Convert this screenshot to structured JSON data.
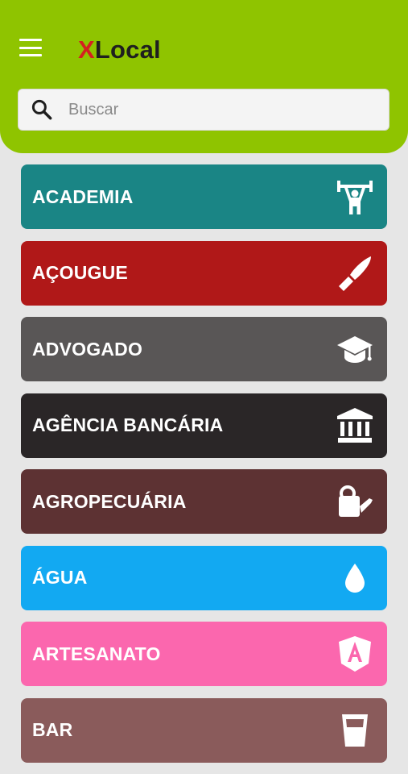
{
  "header": {
    "logo_x": "X",
    "logo_rest": "Local",
    "menu_icon": "hamburger-menu-icon"
  },
  "search": {
    "placeholder": "Buscar",
    "value": "",
    "icon": "search-icon"
  },
  "categories": [
    {
      "label": "ACADEMIA",
      "color": "#1a8585",
      "icon": "weightlifter-icon"
    },
    {
      "label": "AÇOUGUE",
      "color": "#b01818",
      "icon": "knife-icon"
    },
    {
      "label": "ADVOGADO",
      "color": "#595656",
      "icon": "graduation-cap-icon"
    },
    {
      "label": "AGÊNCIA BANCÁRIA",
      "color": "#2a2627",
      "icon": "bank-icon"
    },
    {
      "label": "AGROPECUÁRIA",
      "color": "#5d3233",
      "icon": "watering-can-icon"
    },
    {
      "label": "ÁGUA",
      "color": "#12a9f2",
      "icon": "water-drop-icon"
    },
    {
      "label": "ARTESANATO",
      "color": "#fb67ae",
      "icon": "angular-shield-icon"
    },
    {
      "label": "BAR",
      "color": "#8a5b5b",
      "icon": "glass-icon"
    }
  ]
}
